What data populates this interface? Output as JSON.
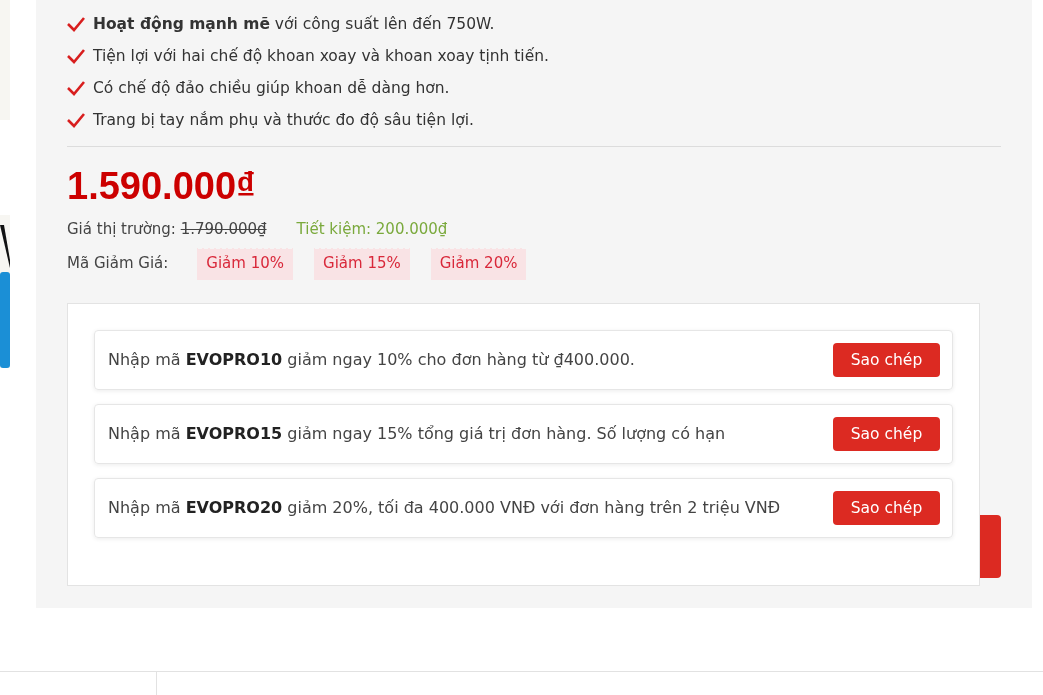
{
  "features": [
    "**Hoạt động mạnh mẽ** với công suất lên đến 750W.",
    "Tiện lợi với hai chế độ khoan xoay và khoan xoay tịnh tiến.",
    "Có chế độ đảo chiều giúp khoan dễ dàng hơn.",
    "Trang bị tay nắm phụ và thước đo độ sâu tiện lợi."
  ],
  "price": "1.590.000₫",
  "market_price": {
    "label": "Giá thị trường:",
    "value": "1.790.000₫"
  },
  "savings": "Tiết kiệm: 200.000₫",
  "coupon_label": "Mã Giảm Giá:",
  "coupon_tags": [
    "Giảm 10%",
    "Giảm 15%",
    "Giảm 20%"
  ],
  "coupons": [
    {
      "text": "Nhập mã  **EVOPRO10**  giảm ngay 10% cho đơn hàng từ ₫400.000.",
      "button": "Sao chép"
    },
    {
      "text": "Nhập mã  **EVOPRO15**  giảm ngay 15% tổng giá trị đơn hàng. Số lượng có hạn",
      "button": "Sao chép"
    },
    {
      "text": "Nhập mã  **EVOPRO20**  giảm 20%, tối đa 400.000 VNĐ với đơn hàng trên 2 triệu VNĐ",
      "button": "Sao chép"
    }
  ]
}
